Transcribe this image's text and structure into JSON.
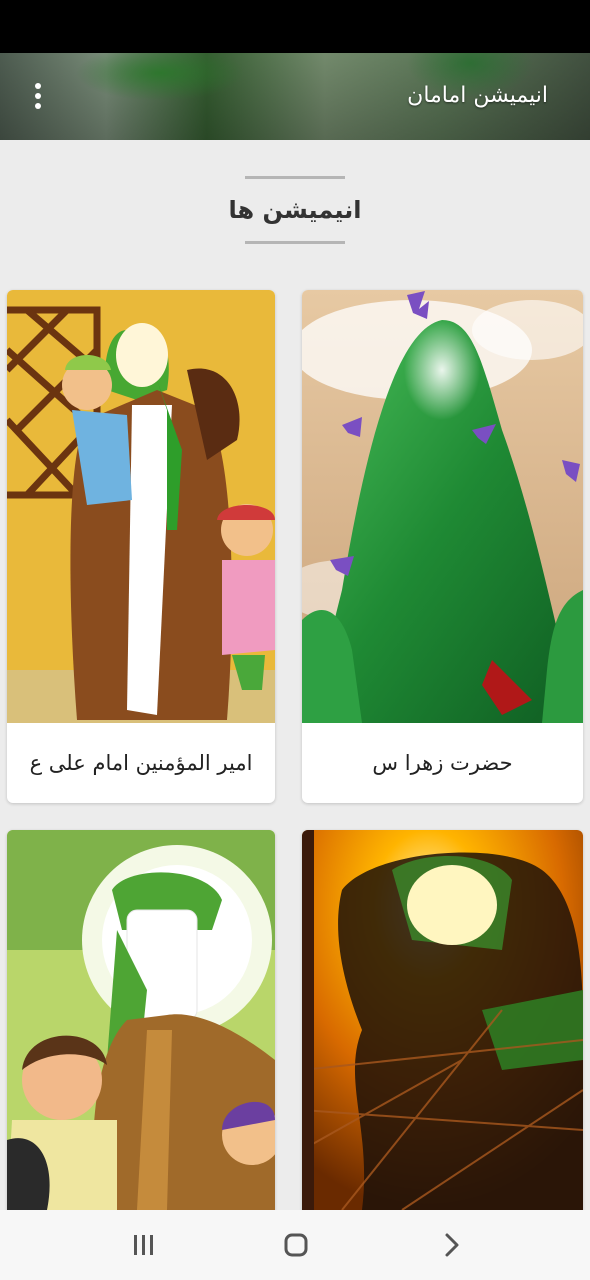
{
  "app_bar": {
    "title": "انیمیشن امامان",
    "menu_icon": "more-vert-icon"
  },
  "section": {
    "title": "انیمیشن ها"
  },
  "cards": [
    {
      "label": "حضرت زهرا س",
      "image": "green-veiled-figure-with-butterflies"
    },
    {
      "label": "امیر المؤمنین امام علی ع",
      "image": "figure-holding-child-cartoon"
    },
    {
      "label": "",
      "image": "warrior-silhouette-with-glowing-face"
    },
    {
      "label": "",
      "image": "green-turban-figure-with-children-cartoon"
    }
  ],
  "nav_bar": {
    "recent_icon": "recent-apps-icon",
    "home_icon": "home-icon",
    "back_icon": "back-icon"
  },
  "colors": {
    "status_bar": "#000000",
    "background": "#ececec",
    "card": "#ffffff",
    "nav_bar": "#f7f7f7",
    "accent_green": "#2e8b3d"
  }
}
